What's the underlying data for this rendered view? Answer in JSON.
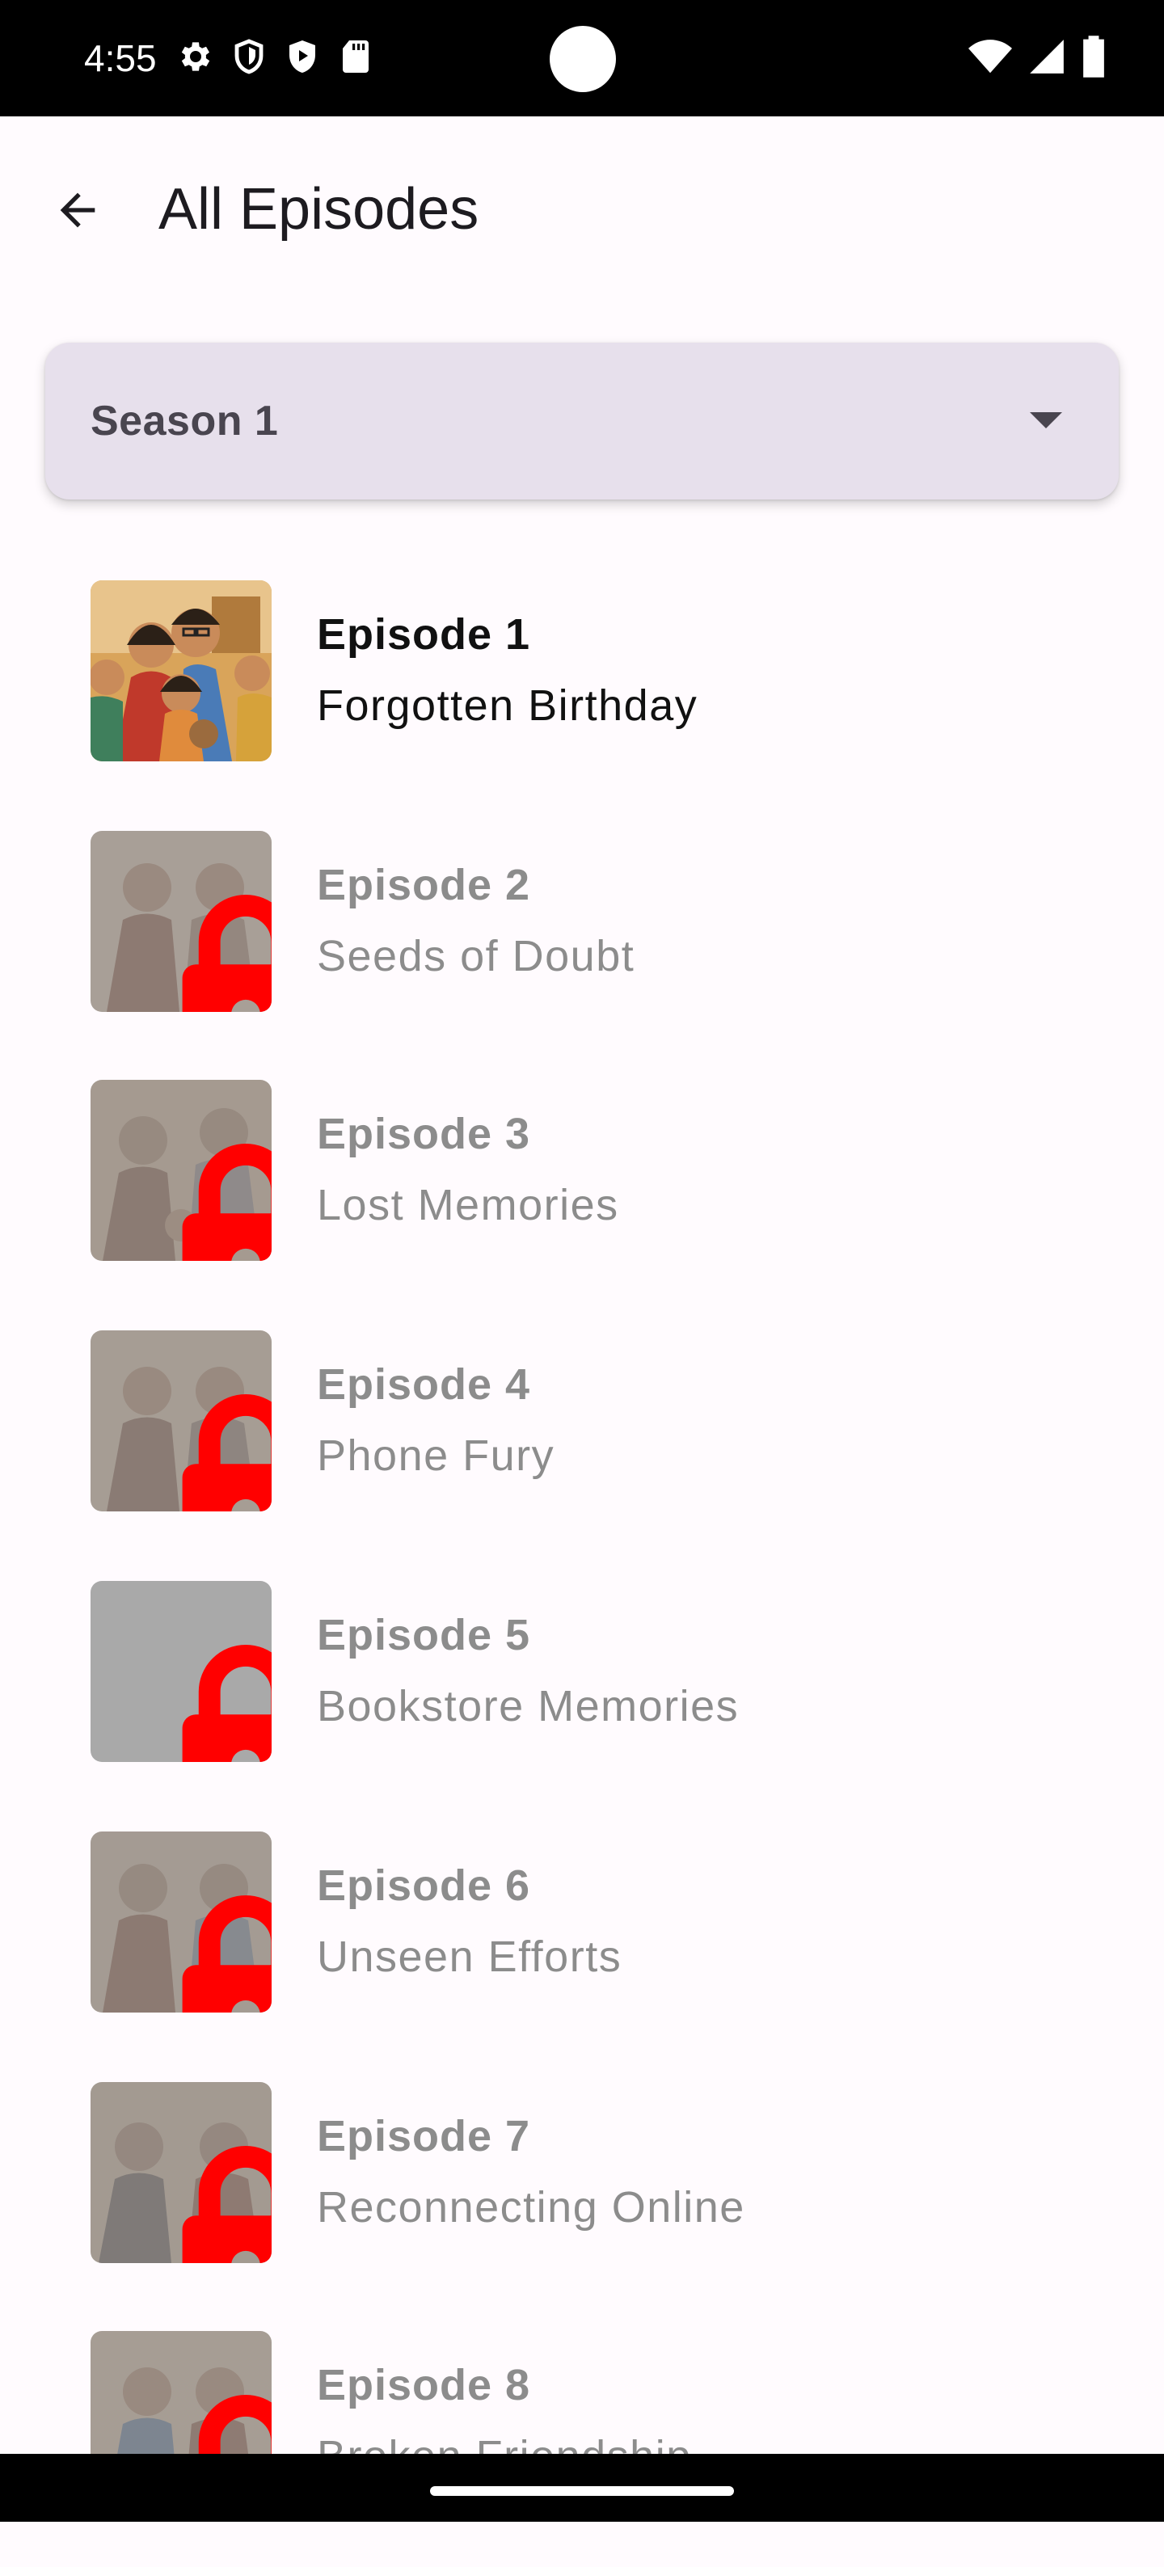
{
  "status_bar": {
    "time": "4:55",
    "left_icons": [
      "gear-icon",
      "shield-icon",
      "play-protect-icon",
      "sd-card-icon"
    ],
    "right_icons": [
      "wifi-icon",
      "signal-icon",
      "battery-icon"
    ]
  },
  "app_bar": {
    "title": "All Episodes",
    "back_icon": "arrow-back-icon"
  },
  "season_select": {
    "value": "Season 1",
    "arrow_icon": "dropdown-arrow-icon"
  },
  "episodes": [
    {
      "number": "Episode 1",
      "title": "Forgotten Birthday",
      "locked": false
    },
    {
      "number": "Episode 2",
      "title": "Seeds of Doubt",
      "locked": true
    },
    {
      "number": "Episode 3",
      "title": "Lost Memories",
      "locked": true
    },
    {
      "number": "Episode 4",
      "title": "Phone Fury",
      "locked": true
    },
    {
      "number": "Episode 5",
      "title": "Bookstore Memories",
      "locked": true
    },
    {
      "number": "Episode 6",
      "title": "Unseen Efforts",
      "locked": true
    },
    {
      "number": "Episode 7",
      "title": "Reconnecting Online",
      "locked": true
    },
    {
      "number": "Episode 8",
      "title": "Broken Friendship",
      "locked": true
    }
  ],
  "colors": {
    "background": "#fffbfe",
    "select_background": "#e7e0ec",
    "lock": "#ff0000",
    "locked_text": "#8c8c8c"
  }
}
